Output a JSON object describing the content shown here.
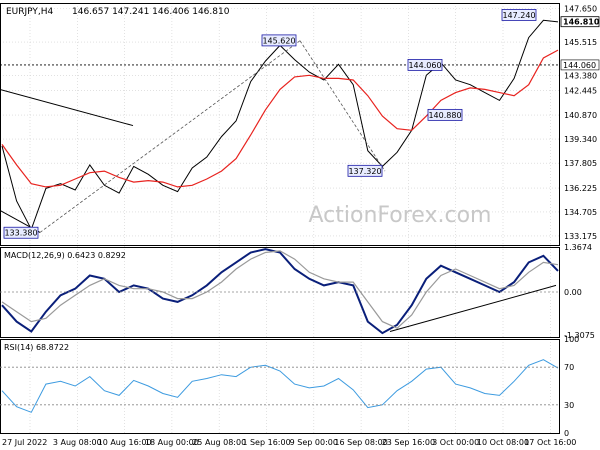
{
  "header": {
    "symbol": "EURJPY,H4",
    "ohlc": "146.657 147.241 146.406 146.810"
  },
  "watermark": "ActionForex.com",
  "colors": {
    "background": "#ffffff",
    "grid": "#cfcfcf",
    "axis": "#000000",
    "price_line": "#000000",
    "ma_line": "#e8231f",
    "macd_line": "#0a1f7a",
    "signal_line": "#9a9a9a",
    "rsi_line": "#3d9be0",
    "label_border": "#1a1aa6",
    "label_fill": "#e8ecff",
    "watermark": "#c8c8c8"
  },
  "chart_data": [
    {
      "type": "line",
      "panel": "price",
      "title": "EURJPY,H4",
      "ylim": [
        132.6,
        148.0
      ],
      "yticks": [
        "147.650",
        "145.515",
        "143.380",
        "142.445",
        "140.870",
        "139.340",
        "137.805",
        "136.225",
        "134.705",
        "133.175"
      ],
      "current_price": "146.810",
      "level_line": "144.060",
      "swing_labels": [
        {
          "text": "133.380",
          "x": "29 Jul 00:00",
          "y": 133.38
        },
        {
          "text": "145.620",
          "x": "9 Sep 00:00",
          "y": 145.62
        },
        {
          "text": "137.320",
          "x": "22 Sep 08:00",
          "y": 137.32
        },
        {
          "text": "144.060",
          "x": "29 Sep 16:00",
          "y": 144.06
        },
        {
          "text": "140.880",
          "x": "12 Oct 00:00",
          "y": 140.88
        },
        {
          "text": "147.240",
          "x": "19 Oct 16:00",
          "y": 147.24
        }
      ],
      "x": [
        "27 Jul 2022",
        "29 Jul",
        "1 Aug",
        "3 Aug",
        "5 Aug",
        "8 Aug",
        "10 Aug",
        "12 Aug",
        "15 Aug",
        "17 Aug",
        "19 Aug",
        "22 Aug",
        "24 Aug",
        "26 Aug",
        "29 Aug",
        "31 Aug",
        "2 Sep",
        "5 Sep",
        "7 Sep",
        "9 Sep",
        "12 Sep",
        "14 Sep",
        "16 Sep",
        "19 Sep",
        "21 Sep",
        "22 Sep",
        "23 Sep",
        "26 Sep",
        "28 Sep",
        "30 Sep",
        "3 Oct",
        "5 Oct",
        "7 Oct",
        "10 Oct",
        "12 Oct",
        "14 Oct",
        "17 Oct",
        "19 Oct",
        "20 Oct"
      ],
      "series": [
        {
          "values": [
            138.9,
            135.4,
            133.6,
            136.2,
            136.5,
            136.1,
            137.7,
            136.4,
            135.9,
            137.6,
            137.1,
            136.4,
            136.0,
            137.5,
            138.2,
            139.5,
            140.5,
            143.0,
            144.3,
            145.3,
            144.4,
            143.6,
            143.1,
            144.1,
            142.8,
            138.6,
            137.6,
            138.5,
            139.9,
            143.4,
            144.2,
            143.1,
            142.8,
            142.3,
            141.8,
            143.2,
            145.8,
            146.9,
            146.8
          ]
        },
        {
          "values": [
            139.0,
            137.7,
            136.5,
            136.3,
            136.4,
            136.8,
            137.2,
            137.3,
            136.9,
            136.6,
            136.7,
            136.6,
            136.3,
            136.4,
            136.8,
            137.3,
            138.1,
            139.6,
            141.2,
            142.5,
            143.3,
            143.4,
            143.2,
            143.2,
            143.1,
            142.1,
            140.8,
            140.0,
            139.9,
            140.8,
            141.8,
            142.3,
            142.6,
            142.5,
            142.3,
            142.1,
            142.8,
            144.5,
            145.0
          ]
        }
      ]
    },
    {
      "type": "line",
      "panel": "macd",
      "title": "MACD(12,26,9) 0.6423 0.8292",
      "ylim": [
        -1.3675,
        1.3674
      ],
      "yticks": [
        "1.3674",
        "0.00",
        "-1.3075"
      ],
      "series": [
        {
          "values": [
            -0.4,
            -0.9,
            -1.2,
            -0.6,
            -0.1,
            0.1,
            0.5,
            0.4,
            0.0,
            0.2,
            0.1,
            -0.2,
            -0.3,
            -0.1,
            0.2,
            0.6,
            0.9,
            1.2,
            1.3,
            1.2,
            0.7,
            0.4,
            0.2,
            0.3,
            0.2,
            -0.9,
            -1.25,
            -1.0,
            -0.4,
            0.4,
            0.8,
            0.6,
            0.4,
            0.2,
            0.0,
            0.3,
            0.9,
            1.1,
            0.64
          ]
        },
        {
          "values": [
            -0.3,
            -0.6,
            -0.9,
            -0.8,
            -0.4,
            -0.1,
            0.2,
            0.4,
            0.2,
            0.1,
            0.1,
            0.0,
            -0.2,
            -0.2,
            0.0,
            0.3,
            0.7,
            1.0,
            1.2,
            1.25,
            1.0,
            0.6,
            0.4,
            0.3,
            0.3,
            -0.3,
            -0.9,
            -1.1,
            -0.7,
            0.0,
            0.5,
            0.7,
            0.5,
            0.3,
            0.1,
            0.2,
            0.6,
            0.9,
            0.83
          ]
        }
      ]
    },
    {
      "type": "line",
      "panel": "rsi",
      "title": "RSI(14) 68.8722",
      "ylim": [
        0,
        100
      ],
      "yticks": [
        "100",
        "70",
        "30",
        "0"
      ],
      "series": [
        {
          "values": [
            45,
            28,
            22,
            52,
            55,
            50,
            60,
            45,
            40,
            56,
            50,
            42,
            38,
            55,
            58,
            62,
            60,
            70,
            72,
            66,
            52,
            48,
            50,
            58,
            46,
            27,
            30,
            45,
            55,
            68,
            70,
            52,
            48,
            42,
            40,
            55,
            72,
            78,
            69
          ]
        }
      ]
    }
  ],
  "xaxis": {
    "labels": [
      "27 Jul 2022",
      "3 Aug 08:00",
      "10 Aug 16:00",
      "18 Aug 00:00",
      "25 Aug 08:00",
      "1 Sep 16:00",
      "9 Sep 00:00",
      "16 Sep 08:00",
      "23 Sep 16:00",
      "3 Oct 00:00",
      "10 Oct 08:00",
      "17 Oct 16:00"
    ]
  }
}
